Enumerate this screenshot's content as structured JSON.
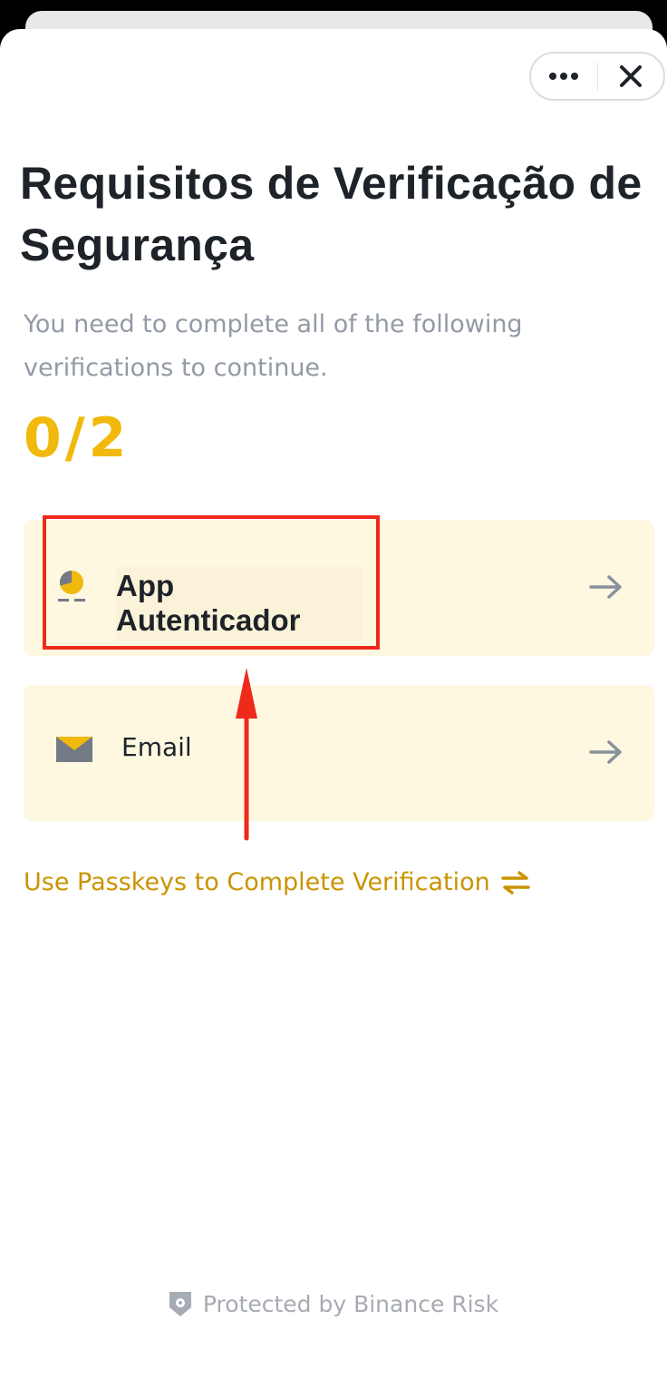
{
  "header": {
    "more_icon": "more-dots-icon",
    "close_icon": "close-x-icon"
  },
  "title": "Requisitos de Verificação de Segurança",
  "subtitle": "You need to complete all of the following verifications to continue.",
  "progress": {
    "text": "0/2",
    "completed": 0,
    "total": 2,
    "color": "#f0b90b"
  },
  "methods": [
    {
      "label": "App Autenticador",
      "icon": "authenticator-icon",
      "arrow_icon": "arrow-right-icon"
    },
    {
      "label": "Email",
      "icon": "email-icon",
      "arrow_icon": "arrow-right-icon"
    }
  ],
  "passkeys": {
    "label": "Use Passkeys to Complete Verification",
    "icon": "swap-arrows-icon"
  },
  "footer": {
    "text": "Protected by Binance Risk",
    "icon": "shield-icon"
  },
  "colors": {
    "accent": "#f0b90b",
    "card_bg": "#fef8e1",
    "annotation": "#ee2a1b",
    "text": "#1e2329",
    "muted": "#929aa5"
  }
}
